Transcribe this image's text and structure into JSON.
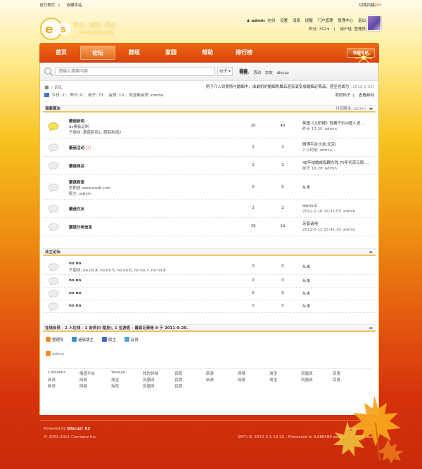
{
  "topbar": {
    "set_home": "设为首页",
    "bookmark": "收藏本站",
    "style_switch": "切换风格",
    "diy": "DIY"
  },
  "logo": {
    "slogan": "专业，创新，真诚",
    "url": "www.eisdl.com"
  },
  "userbar": {
    "username": "admin",
    "status": "在线",
    "links": [
      "设置",
      "消息",
      "提醒",
      "门户管理",
      "管理中心",
      "退出"
    ],
    "credits": "积分: 312",
    "usergroup": "用户组: 管理员"
  },
  "nav": {
    "items": [
      "首页",
      "论坛",
      "群组",
      "家园",
      "帮助",
      "排行榜"
    ],
    "active_index": 1,
    "quicknav": "快捷导航"
  },
  "search": {
    "placeholder": "请输入搜索内容",
    "scope": "帖子",
    "button": "搜索",
    "hot_label": "热搜:",
    "hot_words": [
      "活动",
      "交友",
      "discuz"
    ]
  },
  "breadcrumb": {
    "current": "论坛"
  },
  "announcement": {
    "text": "房子介入到爱情与婚姻中，由最初的婚姻附属品逐渐演变成婚姻必需品，甚至也成为",
    "date": "(2012-2-23)"
  },
  "stats": {
    "today": "今日: 2",
    "yesterday": "昨日: 0",
    "posts": "帖子: 73",
    "members": "会员: 10",
    "welcome_label": "欢迎新会员:",
    "new_member": "momo",
    "my_posts": "我的帖子",
    "view_new": "查看新帖"
  },
  "groups": [
    {
      "title": "海宴廊友",
      "moderator_label": "分区版主:",
      "moderator": "admin",
      "forums": [
        {
          "name": "蘑菇新闻",
          "count": "",
          "desc": "dz模板定制",
          "sub": "子版块: 蘑菇新闻1, 蘑菇新闻2",
          "threads": "20",
          "posts": "40",
          "last_title": "英国《太阳报》吾毒守击中国人说 ...",
          "last_time": "昨天 17:25",
          "last_user": "admin",
          "icon": "new"
        },
        {
          "name": "蘑菇活动",
          "count": "(2)",
          "desc": "",
          "sub": "",
          "threads": "2",
          "posts": "2",
          "last_title": "微博平台沙龙[北京]",
          "last_time": "2 小时前",
          "last_user": "admin",
          "icon": "old"
        },
        {
          "name": "蘑菇商品",
          "count": "",
          "desc": "",
          "sub": "",
          "threads": "1",
          "posts": "2",
          "last_title": "40年结婚戒指翻方钱 70年代百元周 ...",
          "last_time": "前天 16:28",
          "last_user": "admin",
          "icon": "old"
        },
        {
          "name": "蘑菇救查",
          "count": "",
          "desc": "思朗进  www.eisdl.com",
          "sub": "版主: admin",
          "threads": "0",
          "posts": "0",
          "last_title": "从未",
          "last_time": "",
          "last_user": "",
          "icon": "old"
        },
        {
          "name": "蘑菇交友",
          "count": "",
          "desc": "",
          "sub": "",
          "threads": "2",
          "posts": "2",
          "last_title": "admin2",
          "last_time": "2012-2-16 14:31:53",
          "last_user": "admin",
          "icon": "old"
        },
        {
          "name": "蘑菇分类信息",
          "count": "",
          "desc": "",
          "sub": "",
          "threads": "19",
          "posts": "19",
          "last_title": "苏菊请吧",
          "last_time": "2012-2-11 15:41:10",
          "last_user": "admin",
          "icon": "old"
        }
      ]
    },
    {
      "title": "业主论坛",
      "moderator_label": "",
      "moderator": "",
      "forums": [
        {
          "name": "no no",
          "count": "",
          "desc": "",
          "sub": "子版块: no no 4, no no 5, no no 6, no no 7, no no 8",
          "threads": "0",
          "posts": "0",
          "last_title": "从未",
          "last_time": "",
          "last_user": "",
          "icon": "old"
        },
        {
          "name": "no no",
          "count": "",
          "desc": "",
          "sub": "",
          "threads": "0",
          "posts": "0",
          "last_title": "从未",
          "last_time": "",
          "last_user": "",
          "icon": "old"
        },
        {
          "name": "no no",
          "count": "",
          "desc": "",
          "sub": "",
          "threads": "0",
          "posts": "0",
          "last_title": "从未",
          "last_time": "",
          "last_user": "",
          "icon": "old"
        },
        {
          "name": "no no",
          "count": "",
          "desc": "",
          "sub": "",
          "threads": "0",
          "posts": "0",
          "last_title": "从未",
          "last_time": "",
          "last_user": "",
          "icon": "old"
        }
      ]
    }
  ],
  "online": {
    "title": "在线会员 - 2 人在线 - 1 会员(0 隐身), 1 位游客 - 最高记录是 8 于 2011-9-29.",
    "legend": [
      {
        "label": "管理员",
        "color": "#f08a24"
      },
      {
        "label": "超级版主",
        "color": "#2f8fd8"
      },
      {
        "label": "版主",
        "color": "#3b6dc9"
      },
      {
        "label": "会员",
        "color": "#4aa3e0"
      }
    ],
    "user": "admin"
  },
  "friendlinks": [
    "Comsenz",
    "情感平台",
    "Yeswan",
    "我的领域",
    "百度",
    "新浪",
    "网易",
    "淘宝",
    "凤凰网",
    "百度",
    "新浪",
    "网易",
    "淘宝",
    "凤凰网",
    "百度",
    "新浪",
    "网易",
    "淘宝",
    "凤凰网",
    "百度",
    "新浪",
    "网易",
    "淘宝",
    "凤凰网",
    "百度"
  ],
  "footer": {
    "powered_label": "Powered by",
    "powered_name": "Discuz! X2",
    "copyright": "© 2001-2011 Comsenz Inc.",
    "right_top": "Comsenz Inc.",
    "right_bottom": "GMT+8, 2012-3-1 13:22 , Processed in 0.088480 second(s), 4 queries ."
  }
}
